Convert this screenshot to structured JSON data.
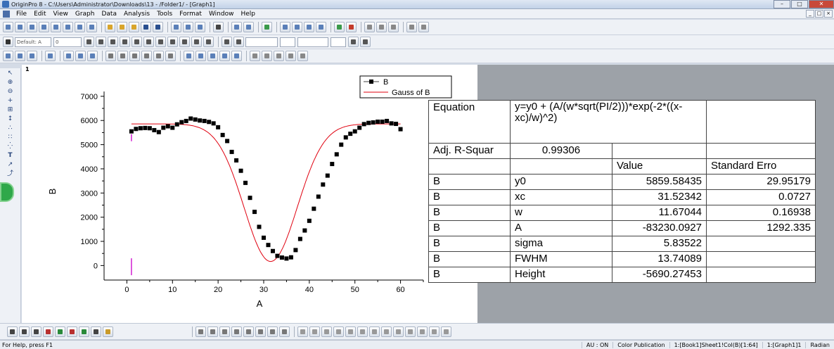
{
  "window": {
    "title": "OriginPro 8 - C:\\Users\\Administrator\\Downloads\\13 - /Folder1/ - [Graph1]"
  },
  "menu": [
    "File",
    "Edit",
    "View",
    "Graph",
    "Data",
    "Analysis",
    "Tools",
    "Format",
    "Window",
    "Help"
  ],
  "toolbar": {
    "font_combo": "Default: A",
    "size_combo": "0"
  },
  "graph": {
    "layer_label": "1"
  },
  "chart_data": {
    "type": "scatter",
    "xlabel": "A",
    "ylabel": "B",
    "xlim": [
      -5,
      65
    ],
    "ylim": [
      -600,
      7200
    ],
    "xticks": [
      0,
      10,
      20,
      30,
      40,
      50,
      60
    ],
    "yticks": [
      0,
      1000,
      2000,
      3000,
      4000,
      5000,
      6000,
      7000
    ],
    "grid": false,
    "legend": {
      "position": "top-right",
      "entries": [
        "B",
        "Gauss of B"
      ]
    },
    "series": [
      {
        "name": "B",
        "marker": "square",
        "color": "#000000",
        "x": [
          1,
          2,
          3,
          4,
          5,
          6,
          7,
          8,
          9,
          10,
          11,
          12,
          13,
          14,
          15,
          16,
          17,
          18,
          19,
          20,
          21,
          22,
          23,
          24,
          25,
          26,
          27,
          28,
          29,
          30,
          31,
          32,
          33,
          34,
          35,
          36,
          37,
          38,
          39,
          40,
          41,
          42,
          43,
          44,
          45,
          46,
          47,
          48,
          49,
          50,
          51,
          52,
          53,
          54,
          55,
          56,
          57,
          58,
          59,
          60
        ],
        "values": [
          5550,
          5650,
          5680,
          5690,
          5680,
          5600,
          5520,
          5700,
          5760,
          5700,
          5840,
          5930,
          5980,
          6080,
          6040,
          6000,
          5980,
          5940,
          5880,
          5720,
          5400,
          5150,
          4700,
          4350,
          3920,
          3420,
          2800,
          2220,
          1600,
          1150,
          850,
          600,
          400,
          330,
          290,
          340,
          640,
          1100,
          1450,
          1850,
          2350,
          2850,
          3350,
          3720,
          4200,
          4600,
          5000,
          5300,
          5450,
          5550,
          5700,
          5850,
          5900,
          5920,
          5950,
          5950,
          5980,
          5880,
          5860,
          5640
        ]
      },
      {
        "name": "Gauss of B",
        "type": "line",
        "color": "#e0000f",
        "model": "gauss",
        "params": {
          "y0": 5859.58435,
          "xc": 31.52342,
          "w": 11.67044,
          "A": -83230.0927
        }
      }
    ]
  },
  "table": {
    "equation_label": "Equation",
    "equation": "y=y0 + (A/(w*sqrt(PI/2)))*exp(-2*((x-xc)/w)^2)",
    "adj_label": "Adj. R-Squar",
    "adj_value": "0.99306",
    "col_value": "Value",
    "col_std": "Standard Erro",
    "rows": [
      {
        "dep": "B",
        "param": "y0",
        "value": "5859.58435",
        "std": "29.95179"
      },
      {
        "dep": "B",
        "param": "xc",
        "value": "31.52342",
        "std": "0.0727"
      },
      {
        "dep": "B",
        "param": "w",
        "value": "11.67044",
        "std": "0.16938"
      },
      {
        "dep": "B",
        "param": "A",
        "value": "-83230.0927",
        "std": "1292.335"
      },
      {
        "dep": "B",
        "param": "sigma",
        "value": "5.83522",
        "std": ""
      },
      {
        "dep": "B",
        "param": "FWHM",
        "value": "13.74089",
        "std": ""
      },
      {
        "dep": "B",
        "param": "Height",
        "value": "-5690.27453",
        "std": ""
      }
    ]
  },
  "status": {
    "help": "For Help, press F1",
    "autoupdate": "AU : ON",
    "color_mode": "Color Publication",
    "active_book": "1:[Book1]Sheet1!Col(B)[1:64]",
    "active_graph": "1:[Graph1]1",
    "angle_unit": "Radian"
  }
}
